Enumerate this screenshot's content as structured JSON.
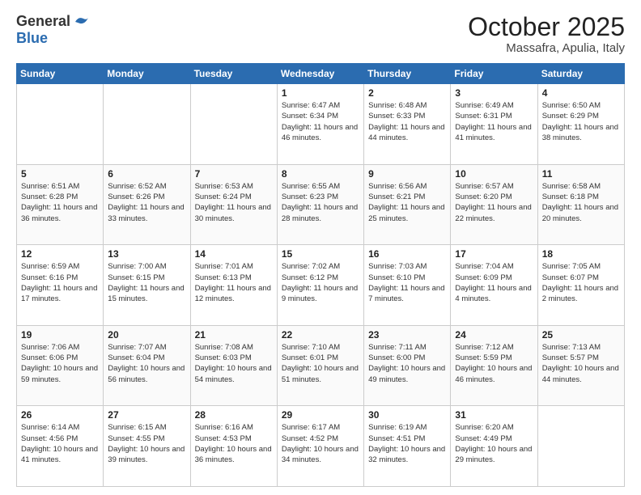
{
  "header": {
    "logo_general": "General",
    "logo_blue": "Blue",
    "month": "October 2025",
    "location": "Massafra, Apulia, Italy"
  },
  "days_of_week": [
    "Sunday",
    "Monday",
    "Tuesday",
    "Wednesday",
    "Thursday",
    "Friday",
    "Saturday"
  ],
  "weeks": [
    [
      {
        "day": "",
        "info": ""
      },
      {
        "day": "",
        "info": ""
      },
      {
        "day": "",
        "info": ""
      },
      {
        "day": "1",
        "info": "Sunrise: 6:47 AM\nSunset: 6:34 PM\nDaylight: 11 hours and 46 minutes."
      },
      {
        "day": "2",
        "info": "Sunrise: 6:48 AM\nSunset: 6:33 PM\nDaylight: 11 hours and 44 minutes."
      },
      {
        "day": "3",
        "info": "Sunrise: 6:49 AM\nSunset: 6:31 PM\nDaylight: 11 hours and 41 minutes."
      },
      {
        "day": "4",
        "info": "Sunrise: 6:50 AM\nSunset: 6:29 PM\nDaylight: 11 hours and 38 minutes."
      }
    ],
    [
      {
        "day": "5",
        "info": "Sunrise: 6:51 AM\nSunset: 6:28 PM\nDaylight: 11 hours and 36 minutes."
      },
      {
        "day": "6",
        "info": "Sunrise: 6:52 AM\nSunset: 6:26 PM\nDaylight: 11 hours and 33 minutes."
      },
      {
        "day": "7",
        "info": "Sunrise: 6:53 AM\nSunset: 6:24 PM\nDaylight: 11 hours and 30 minutes."
      },
      {
        "day": "8",
        "info": "Sunrise: 6:55 AM\nSunset: 6:23 PM\nDaylight: 11 hours and 28 minutes."
      },
      {
        "day": "9",
        "info": "Sunrise: 6:56 AM\nSunset: 6:21 PM\nDaylight: 11 hours and 25 minutes."
      },
      {
        "day": "10",
        "info": "Sunrise: 6:57 AM\nSunset: 6:20 PM\nDaylight: 11 hours and 22 minutes."
      },
      {
        "day": "11",
        "info": "Sunrise: 6:58 AM\nSunset: 6:18 PM\nDaylight: 11 hours and 20 minutes."
      }
    ],
    [
      {
        "day": "12",
        "info": "Sunrise: 6:59 AM\nSunset: 6:16 PM\nDaylight: 11 hours and 17 minutes."
      },
      {
        "day": "13",
        "info": "Sunrise: 7:00 AM\nSunset: 6:15 PM\nDaylight: 11 hours and 15 minutes."
      },
      {
        "day": "14",
        "info": "Sunrise: 7:01 AM\nSunset: 6:13 PM\nDaylight: 11 hours and 12 minutes."
      },
      {
        "day": "15",
        "info": "Sunrise: 7:02 AM\nSunset: 6:12 PM\nDaylight: 11 hours and 9 minutes."
      },
      {
        "day": "16",
        "info": "Sunrise: 7:03 AM\nSunset: 6:10 PM\nDaylight: 11 hours and 7 minutes."
      },
      {
        "day": "17",
        "info": "Sunrise: 7:04 AM\nSunset: 6:09 PM\nDaylight: 11 hours and 4 minutes."
      },
      {
        "day": "18",
        "info": "Sunrise: 7:05 AM\nSunset: 6:07 PM\nDaylight: 11 hours and 2 minutes."
      }
    ],
    [
      {
        "day": "19",
        "info": "Sunrise: 7:06 AM\nSunset: 6:06 PM\nDaylight: 10 hours and 59 minutes."
      },
      {
        "day": "20",
        "info": "Sunrise: 7:07 AM\nSunset: 6:04 PM\nDaylight: 10 hours and 56 minutes."
      },
      {
        "day": "21",
        "info": "Sunrise: 7:08 AM\nSunset: 6:03 PM\nDaylight: 10 hours and 54 minutes."
      },
      {
        "day": "22",
        "info": "Sunrise: 7:10 AM\nSunset: 6:01 PM\nDaylight: 10 hours and 51 minutes."
      },
      {
        "day": "23",
        "info": "Sunrise: 7:11 AM\nSunset: 6:00 PM\nDaylight: 10 hours and 49 minutes."
      },
      {
        "day": "24",
        "info": "Sunrise: 7:12 AM\nSunset: 5:59 PM\nDaylight: 10 hours and 46 minutes."
      },
      {
        "day": "25",
        "info": "Sunrise: 7:13 AM\nSunset: 5:57 PM\nDaylight: 10 hours and 44 minutes."
      }
    ],
    [
      {
        "day": "26",
        "info": "Sunrise: 6:14 AM\nSunset: 4:56 PM\nDaylight: 10 hours and 41 minutes."
      },
      {
        "day": "27",
        "info": "Sunrise: 6:15 AM\nSunset: 4:55 PM\nDaylight: 10 hours and 39 minutes."
      },
      {
        "day": "28",
        "info": "Sunrise: 6:16 AM\nSunset: 4:53 PM\nDaylight: 10 hours and 36 minutes."
      },
      {
        "day": "29",
        "info": "Sunrise: 6:17 AM\nSunset: 4:52 PM\nDaylight: 10 hours and 34 minutes."
      },
      {
        "day": "30",
        "info": "Sunrise: 6:19 AM\nSunset: 4:51 PM\nDaylight: 10 hours and 32 minutes."
      },
      {
        "day": "31",
        "info": "Sunrise: 6:20 AM\nSunset: 4:49 PM\nDaylight: 10 hours and 29 minutes."
      },
      {
        "day": "",
        "info": ""
      }
    ]
  ]
}
